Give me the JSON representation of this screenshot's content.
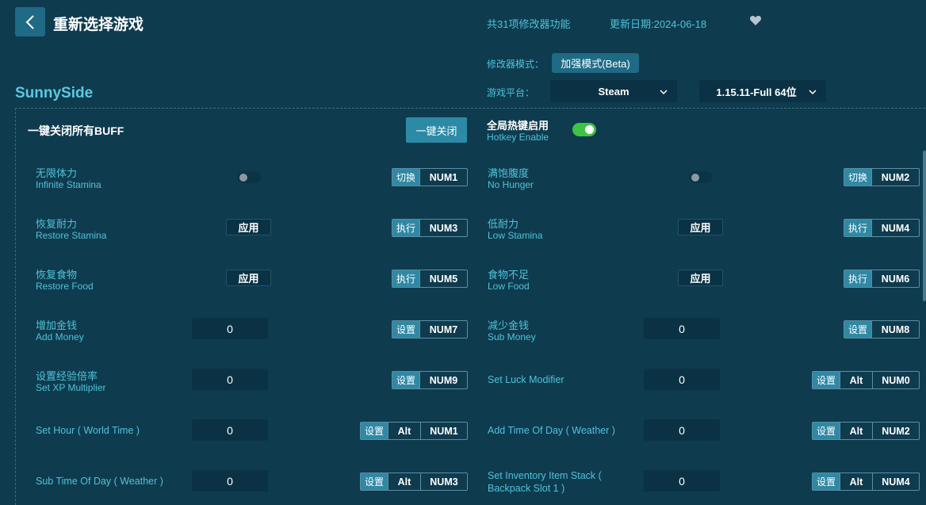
{
  "header": {
    "title": "重新选择游戏",
    "feature_count": "共31项修改器功能",
    "update_date": "更新日期:2024-06-18",
    "mode_label": "修改器模式：",
    "mode_value": "加强模式(Beta)",
    "platform_label": "游戏平台：",
    "platform_value": "Steam",
    "version_value": "1.15.11-Full 64位"
  },
  "game_name": "SunnySide",
  "buff": {
    "title": "一键关闭所有BUFF",
    "button": "一键关闭"
  },
  "hotkey": {
    "zh": "全局热键启用",
    "en": "Hotkey Enable",
    "enabled": true
  },
  "items": {
    "infinite_stamina": {
      "zh": "无限体力",
      "en": "Infinite Stamina",
      "state": false,
      "action": "切换",
      "key": "NUM1"
    },
    "no_hunger": {
      "zh": "满饱腹度",
      "en": "No Hunger",
      "state": false,
      "action": "切换",
      "key": "NUM2"
    },
    "restore_stamina": {
      "zh": "恢复耐力",
      "en": "Restore Stamina",
      "button": "应用",
      "action": "执行",
      "key": "NUM3"
    },
    "low_stamina": {
      "zh": "低耐力",
      "en": "Low Stamina",
      "button": "应用",
      "action": "执行",
      "key": "NUM4"
    },
    "restore_food": {
      "zh": "恢复食物",
      "en": "Restore Food",
      "button": "应用",
      "action": "执行",
      "key": "NUM5"
    },
    "low_food": {
      "zh": "食物不足",
      "en": "Low Food",
      "button": "应用",
      "action": "执行",
      "key": "NUM6"
    },
    "add_money": {
      "zh": "增加金钱",
      "en": "Add Money",
      "value": "0",
      "action": "设置",
      "key": "NUM7"
    },
    "sub_money": {
      "zh": "减少金钱",
      "en": "Sub Money",
      "value": "0",
      "action": "设置",
      "key": "NUM8"
    },
    "xp_multiplier": {
      "zh": "设置经验倍率",
      "en": "Set XP Multiplier",
      "value": "0",
      "action": "设置",
      "key": "NUM9"
    },
    "luck_modifier": {
      "label": "Set Luck Modifier",
      "value": "0",
      "action": "设置",
      "mod": "Alt",
      "key": "NUM0"
    },
    "set_hour": {
      "label": "Set Hour ( World Time )",
      "value": "0",
      "action": "设置",
      "mod": "Alt",
      "key": "NUM1"
    },
    "add_time": {
      "label": "Add Time Of Day ( Weather )",
      "value": "0",
      "action": "设置",
      "mod": "Alt",
      "key": "NUM2"
    },
    "sub_time": {
      "label": "Sub Time Of Day ( Weather )",
      "value": "0",
      "action": "设置",
      "mod": "Alt",
      "key": "NUM3"
    },
    "inventory_stack": {
      "label": "Set Inventory Item Stack (",
      "label2": "Backpack Slot 1 )",
      "value": "0",
      "action": "设置",
      "mod": "Alt",
      "key": "NUM4"
    }
  },
  "colors": {
    "background": "#0f3b4f",
    "accent": "#4ec3d9",
    "toggle_on": "#3fc342",
    "button": "#2d8aa6"
  },
  "icons": {
    "back": "chevron-left-icon",
    "favorite": "heart-icon",
    "dropdown": "chevron-down-icon"
  }
}
